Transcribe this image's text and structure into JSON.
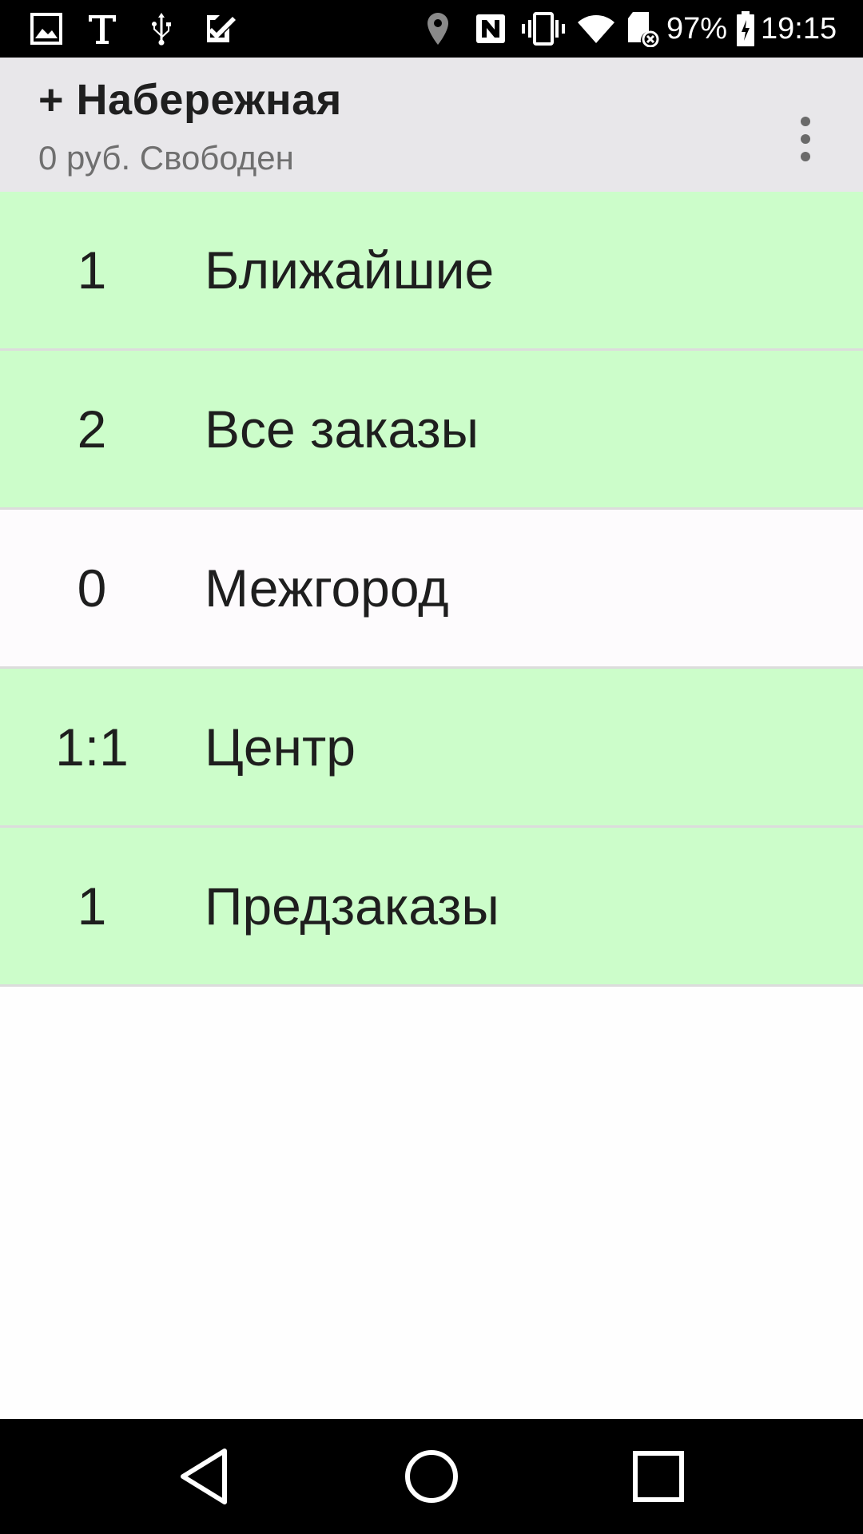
{
  "status_bar": {
    "left_icons": [
      "image-icon",
      "text-icon",
      "usb-icon",
      "checkmark-icon"
    ],
    "right_icons": [
      "location-icon",
      "nfc-icon",
      "vibrate-icon",
      "wifi-icon",
      "sd-card-icon"
    ],
    "battery": "97%",
    "time": "19:15"
  },
  "app_bar": {
    "title": "+ Набережная",
    "subtitle": "0 руб. Свободен",
    "overflow_icon": "more-vert-icon"
  },
  "list": {
    "items": [
      {
        "count": "1",
        "label": "Ближайшие",
        "active": true
      },
      {
        "count": "2",
        "label": "Все заказы",
        "active": true
      },
      {
        "count": "0",
        "label": "Межгород",
        "active": false
      },
      {
        "count": "1:1",
        "label": "Центр",
        "active": true
      },
      {
        "count": "1",
        "label": "Предзаказы",
        "active": true
      }
    ]
  },
  "nav_bar": {
    "buttons": [
      "back-icon",
      "home-icon",
      "recents-icon"
    ]
  },
  "colors": {
    "active_row": "#ccfdca",
    "inactive_row": "#fdfbfd",
    "app_bar": "#e8e7ea",
    "divider": "#dcdcdc"
  }
}
